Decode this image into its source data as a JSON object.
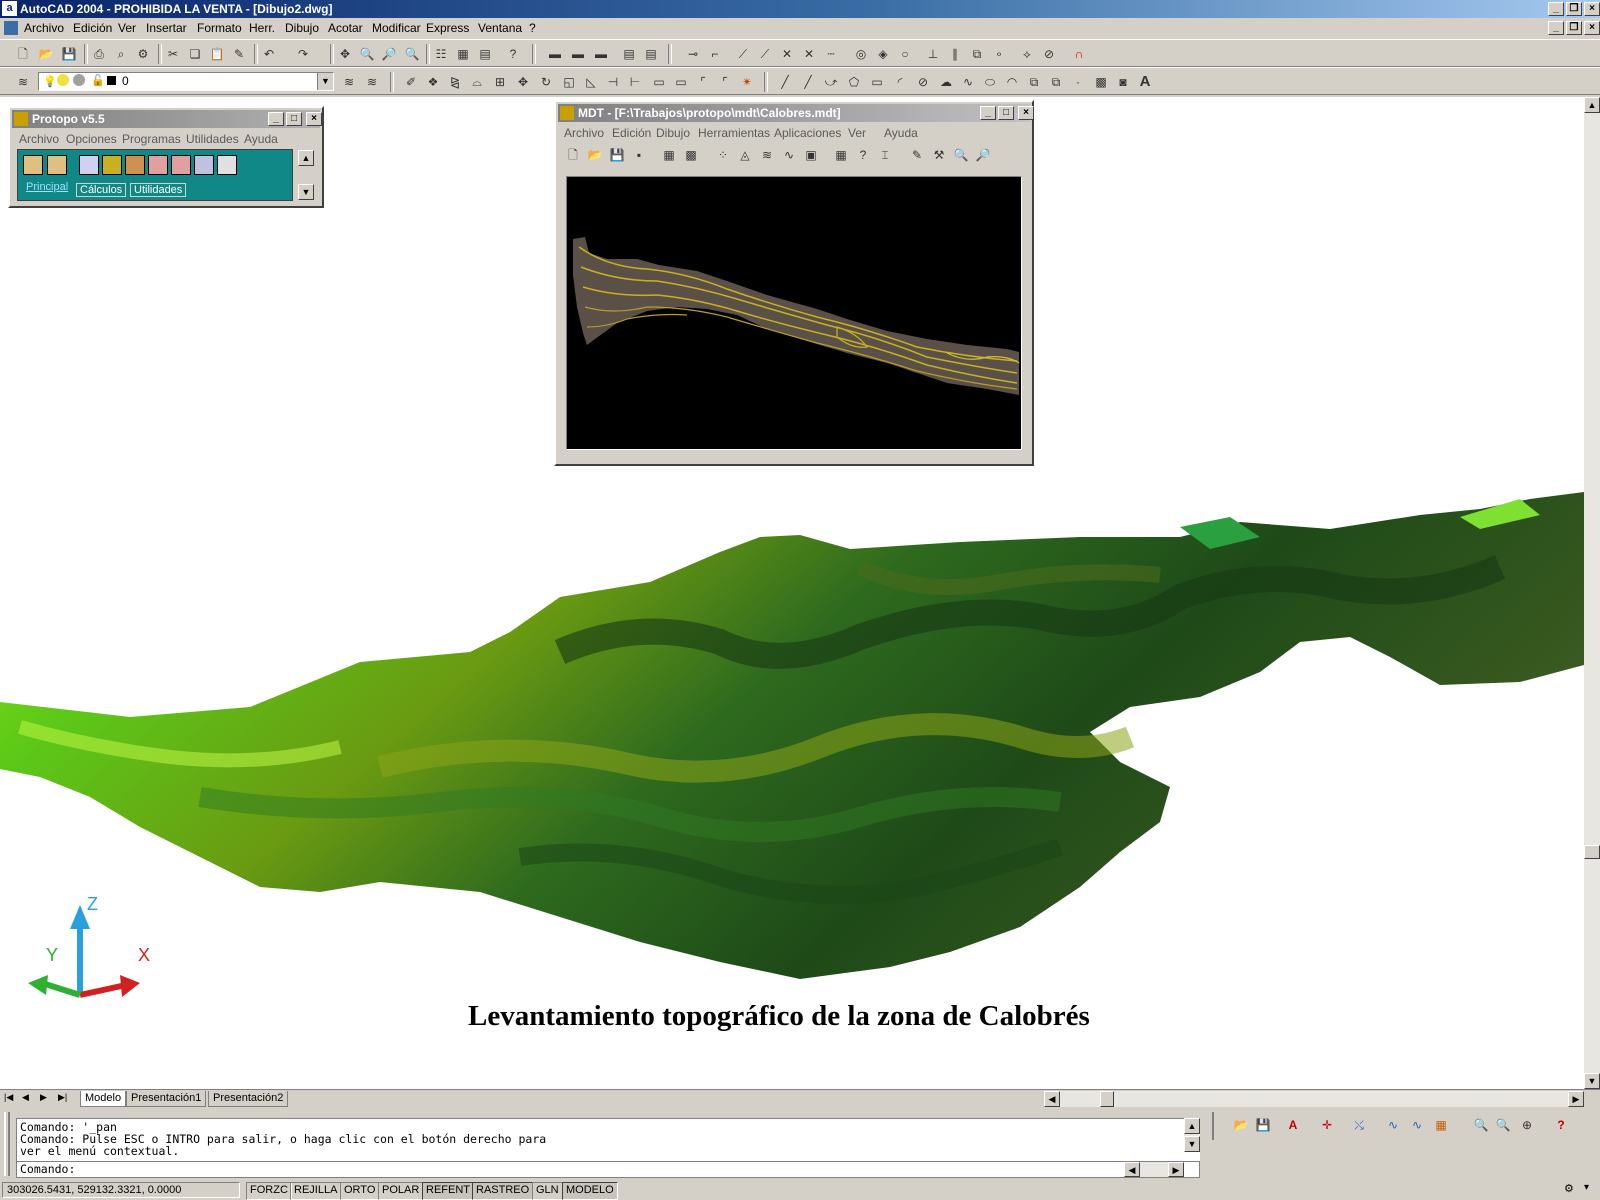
{
  "app": {
    "title": "AutoCAD 2004 - PROHIBIDA LA VENTA - [Dibujo2.dwg]",
    "icon_letter": "a"
  },
  "menu": [
    "Archivo",
    "Edición",
    "Ver",
    "Insertar",
    "Formato",
    "Herr.",
    "Dibujo",
    "Acotar",
    "Modificar",
    "Express",
    "Ventana",
    "?"
  ],
  "layer_toolbar": {
    "current_layer": "0"
  },
  "protopo": {
    "title": "Protopo v5.5",
    "menu": [
      "Archivo",
      "Opciones",
      "Programas",
      "Utilidades",
      "Ayuda"
    ],
    "tabs": [
      "Principal",
      "Cálculos",
      "Utilidades"
    ]
  },
  "mdt": {
    "title": "MDT - [F:\\Trabajos\\protopo\\mdt\\Calobres.mdt]",
    "menu": [
      "Archivo",
      "Edición",
      "Dibujo",
      "Herramientas",
      "Aplicaciones",
      "Ver",
      "Ayuda"
    ]
  },
  "drawing": {
    "title_text": "Levantamiento topográfico de la zona de Calobrés",
    "ucs": {
      "x": "X",
      "y": "Y",
      "z": "Z"
    }
  },
  "layout_tabs": [
    "Modelo",
    "Presentación1",
    "Presentación2"
  ],
  "command": {
    "history": [
      "Comando: '_pan",
      "Comando: Pulse ESC o INTRO para salir, o haga clic con el botón derecho para",
      "ver el menú contextual."
    ],
    "prompt": "Comando:"
  },
  "status": {
    "coords": "303026.5431, 529132.3321, 0.0000",
    "buttons": [
      "FORZC",
      "REJILLA",
      "ORTO",
      "POLAR",
      "REFENT",
      "RASTREO",
      "GLN",
      "MODELO"
    ],
    "active": [
      "REFENT",
      "RASTREO",
      "MODELO"
    ]
  },
  "colors": {
    "title_start": "#0a246a",
    "title_end": "#a6caf0",
    "terrain_light": "#7ed60a",
    "terrain_dark": "#1f3d14",
    "ucs_z": "#2a9fe0",
    "ucs_x": "#d02020",
    "ucs_y": "#30b030"
  }
}
